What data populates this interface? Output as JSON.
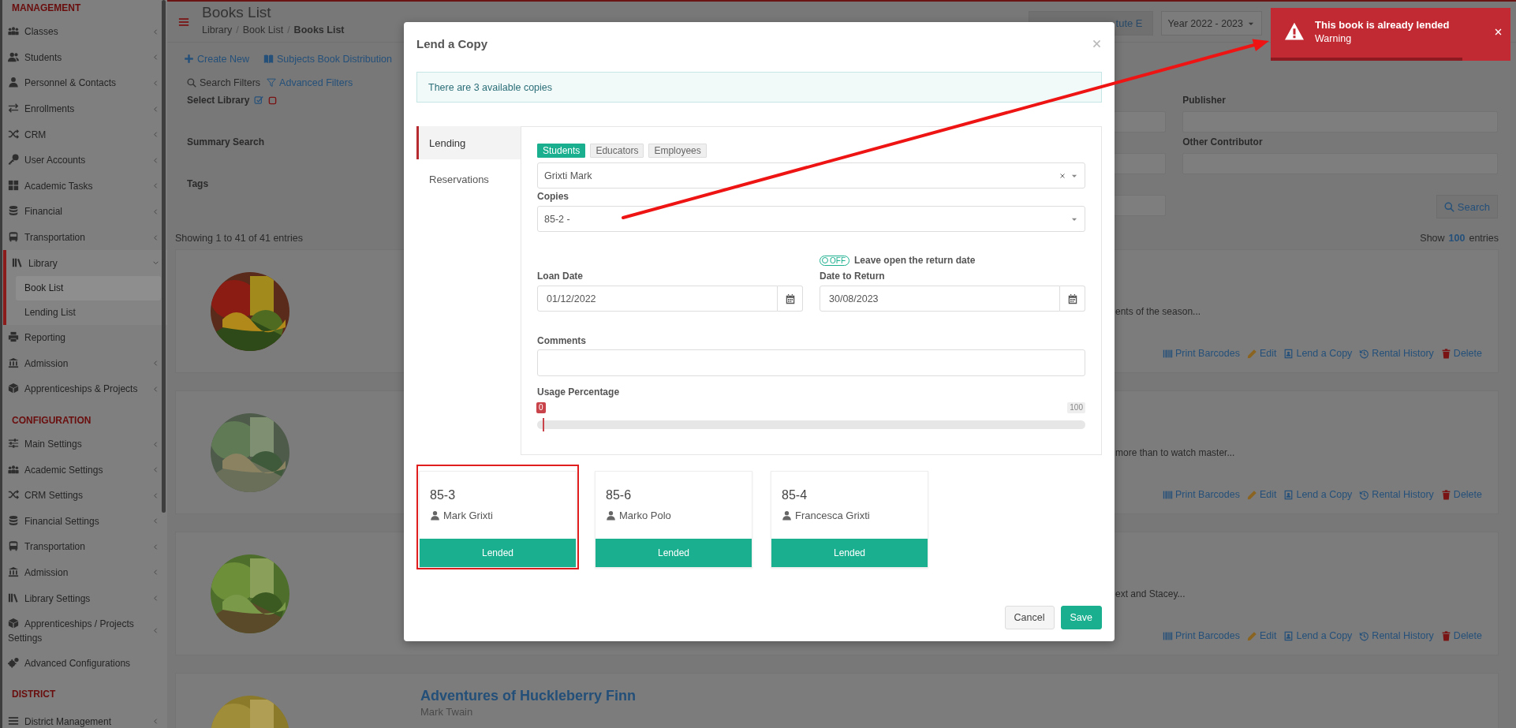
{
  "sidebar": {
    "sections": [
      {
        "title": "MANAGEMENT",
        "items": [
          {
            "label": "Classes",
            "expanded": false
          },
          {
            "label": "Students",
            "expanded": false
          },
          {
            "label": "Personnel & Contacts",
            "expanded": false
          },
          {
            "label": "Enrollments",
            "expanded": false
          },
          {
            "label": "CRM",
            "expanded": false
          },
          {
            "label": "User Accounts",
            "expanded": false
          },
          {
            "label": "Academic Tasks",
            "expanded": false
          },
          {
            "label": "Financial",
            "expanded": false
          },
          {
            "label": "Transportation",
            "expanded": false
          },
          {
            "label": "Library",
            "expanded": true,
            "children": [
              {
                "label": "Book List",
                "selected": true
              },
              {
                "label": "Lending List",
                "selected": false
              }
            ]
          },
          {
            "label": "Reporting"
          },
          {
            "label": "Admission",
            "expanded": false
          },
          {
            "label": "Apprenticeships & Projects",
            "expanded": false
          }
        ]
      },
      {
        "title": "CONFIGURATION",
        "items": [
          {
            "label": "Main Settings",
            "expanded": false
          },
          {
            "label": "Academic Settings",
            "expanded": false
          },
          {
            "label": "CRM Settings",
            "expanded": false
          },
          {
            "label": "Financial Settings",
            "expanded": false
          },
          {
            "label": "Transportation",
            "expanded": false
          },
          {
            "label": "Admission",
            "expanded": false
          },
          {
            "label": "Library Settings",
            "expanded": false
          },
          {
            "label": "Apprenticeships / Projects Settings",
            "expanded": false
          },
          {
            "label": "Advanced Configurations"
          }
        ]
      },
      {
        "title": "DISTRICT",
        "items": [
          {
            "label": "District Management",
            "expanded": false
          }
        ]
      }
    ]
  },
  "header": {
    "title": "Books List",
    "breadcrumb": [
      {
        "label": "Library",
        "kind": "link"
      },
      {
        "label": "/",
        "kind": "separator"
      },
      {
        "label": "Book List",
        "kind": "link"
      },
      {
        "label": "/",
        "kind": "separator"
      },
      {
        "label": "Books List",
        "kind": "current"
      }
    ],
    "institute": "tute E",
    "year": "Year 2022 - 2023"
  },
  "toolbar": [
    "Create New",
    "Subjects Book Distribution"
  ],
  "filters": {
    "tabs": [
      "Search Filters",
      "Advanced Filters"
    ],
    "rows": [
      {
        "first": {
          "label": "Select Library"
        },
        "last": {
          "label": "Publisher"
        }
      },
      {
        "first": {
          "label": "Summary Search"
        },
        "last": {
          "label": "Other Contributor"
        }
      },
      {
        "first": {
          "label": "Tags"
        }
      }
    ],
    "search_button": "Search"
  },
  "listing": {
    "summary": "Showing 1 to 41 of 41 entries",
    "show_label": "Show",
    "page_size": "100",
    "entries_label": "entries"
  },
  "books": [
    {
      "description": "ents of the season...",
      "actions": [
        "Print Barcodes",
        "Edit",
        "Lend a Copy",
        "Rental History",
        "Delete"
      ]
    },
    {
      "description": "more than to watch master...",
      "actions": [
        "Print Barcodes",
        "Edit",
        "Lend a Copy",
        "Rental History",
        "Delete"
      ]
    },
    {
      "description": "ext and Stacey...",
      "actions": [
        "Print Barcodes",
        "Edit",
        "Lend a Copy",
        "Rental History",
        "Delete"
      ]
    },
    {
      "title": "Adventures of Huckleberry Finn",
      "author": "Mark Twain"
    }
  ],
  "modal": {
    "title": "Lend a Copy",
    "info": "There are 3 available copies",
    "side_tabs": [
      {
        "label": "Lending",
        "selected": true
      },
      {
        "label": "Reservations",
        "selected": false
      }
    ],
    "borrower_types": [
      {
        "label": "Students",
        "selected": true
      },
      {
        "label": "Educators",
        "selected": false
      },
      {
        "label": "Employees",
        "selected": false
      }
    ],
    "borrower": "Grixti Mark",
    "copies_label": "Copies",
    "copy": "85-2 -",
    "toggle": {
      "label": "OFF",
      "on": false
    },
    "toggle_caption": "Leave open the return date",
    "loan_date_label": "Loan Date",
    "loan_date": "01/12/2022",
    "return_label": "Date to Return",
    "return_date": "30/08/2023",
    "comments_label": "Comments",
    "usage_label": "Usage Percentage",
    "usage": {
      "value": "0",
      "max": "100",
      "level": 0
    },
    "copies": [
      {
        "code": "85-3",
        "borrower": "Mark Grixti",
        "status": "Lended",
        "highlighted": true
      },
      {
        "code": "85-6",
        "borrower": "Marko Polo",
        "status": "Lended",
        "highlighted": false
      },
      {
        "code": "85-4",
        "borrower": "Francesca Grixti",
        "status": "Lended",
        "highlighted": false
      }
    ],
    "buttons": [
      {
        "label": "Cancel",
        "kind": "secondary"
      },
      {
        "label": "Save",
        "kind": "primary"
      }
    ]
  },
  "toast": {
    "title": "This book is already lended",
    "subtitle": "Warning",
    "level": 0.8
  }
}
